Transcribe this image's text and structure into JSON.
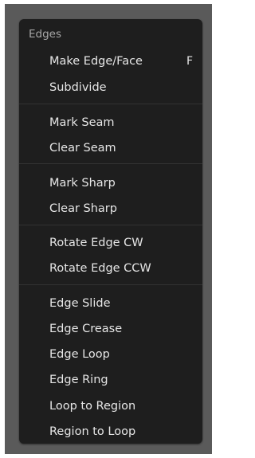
{
  "menu": {
    "title": "Edges",
    "items": [
      {
        "label": "Make Edge/Face",
        "shortcut": "F"
      },
      {
        "label": "Subdivide",
        "shortcut": ""
      },
      {
        "label": "Mark Seam",
        "shortcut": ""
      },
      {
        "label": "Clear Seam",
        "shortcut": ""
      },
      {
        "label": "Mark Sharp",
        "shortcut": ""
      },
      {
        "label": "Clear Sharp",
        "shortcut": ""
      },
      {
        "label": "Rotate Edge CW",
        "shortcut": ""
      },
      {
        "label": "Rotate Edge CCW",
        "shortcut": ""
      },
      {
        "label": "Edge Slide",
        "shortcut": ""
      },
      {
        "label": "Edge Crease",
        "shortcut": ""
      },
      {
        "label": "Edge Loop",
        "shortcut": ""
      },
      {
        "label": "Edge Ring",
        "shortcut": ""
      },
      {
        "label": "Loop to Region",
        "shortcut": ""
      },
      {
        "label": "Region to Loop",
        "shortcut": ""
      }
    ]
  },
  "colors": {
    "frame_background": "#5a5a5a",
    "menu_background": "#1e1e1e",
    "title_text": "#a8a8a8",
    "item_text": "#e6e6e6",
    "separator": "#333333"
  }
}
